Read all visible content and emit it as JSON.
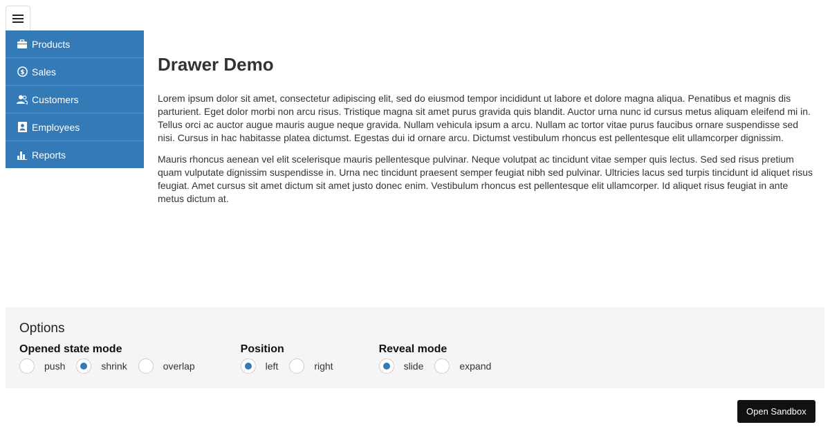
{
  "drawer": {
    "items": [
      {
        "label": "Products",
        "icon": "briefcase-icon"
      },
      {
        "label": "Sales",
        "icon": "dollar-icon"
      },
      {
        "label": "Customers",
        "icon": "users-icon"
      },
      {
        "label": "Employees",
        "icon": "id-card-icon"
      },
      {
        "label": "Reports",
        "icon": "bar-chart-icon"
      }
    ],
    "background": "#337ab7"
  },
  "content": {
    "title": "Drawer Demo",
    "paragraphs": [
      "Lorem ipsum dolor sit amet, consectetur adipiscing elit, sed do eiusmod tempor incididunt ut labore et dolore magna aliqua. Penatibus et magnis dis parturient. Eget dolor morbi non arcu risus. Tristique magna sit amet purus gravida quis blandit. Auctor urna nunc id cursus metus aliquam eleifend mi in. Tellus orci ac auctor augue mauris augue neque gravida. Nullam vehicula ipsum a arcu. Nullam ac tortor vitae purus faucibus ornare suspendisse sed nisi. Cursus in hac habitasse platea dictumst. Egestas dui id ornare arcu. Dictumst vestibulum rhoncus est pellentesque elit ullamcorper dignissim.",
      "Mauris rhoncus aenean vel elit scelerisque mauris pellentesque pulvinar. Neque volutpat ac tincidunt vitae semper quis lectus. Sed sed risus pretium quam vulputate dignissim suspendisse in. Urna nec tincidunt praesent semper feugiat nibh sed pulvinar. Ultricies lacus sed turpis tincidunt id aliquet risus feugiat. Amet cursus sit amet dictum sit amet justo donec enim. Vestibulum rhoncus est pellentesque elit ullamcorper. Id aliquet risus feugiat in ante metus dictum at."
    ]
  },
  "options": {
    "title": "Options",
    "groups": [
      {
        "label": "Opened state mode",
        "radios": [
          {
            "label": "push",
            "checked": false
          },
          {
            "label": "shrink",
            "checked": true
          },
          {
            "label": "overlap",
            "checked": false
          }
        ]
      },
      {
        "label": "Position",
        "radios": [
          {
            "label": "left",
            "checked": true
          },
          {
            "label": "right",
            "checked": false
          }
        ]
      },
      {
        "label": "Reveal mode",
        "radios": [
          {
            "label": "slide",
            "checked": true
          },
          {
            "label": "expand",
            "checked": false
          }
        ]
      }
    ]
  },
  "sandbox": {
    "label": "Open Sandbox"
  },
  "colors": {
    "accent": "#337ab7",
    "options_bg": "#f5f5f5",
    "button_bg": "#111111"
  }
}
